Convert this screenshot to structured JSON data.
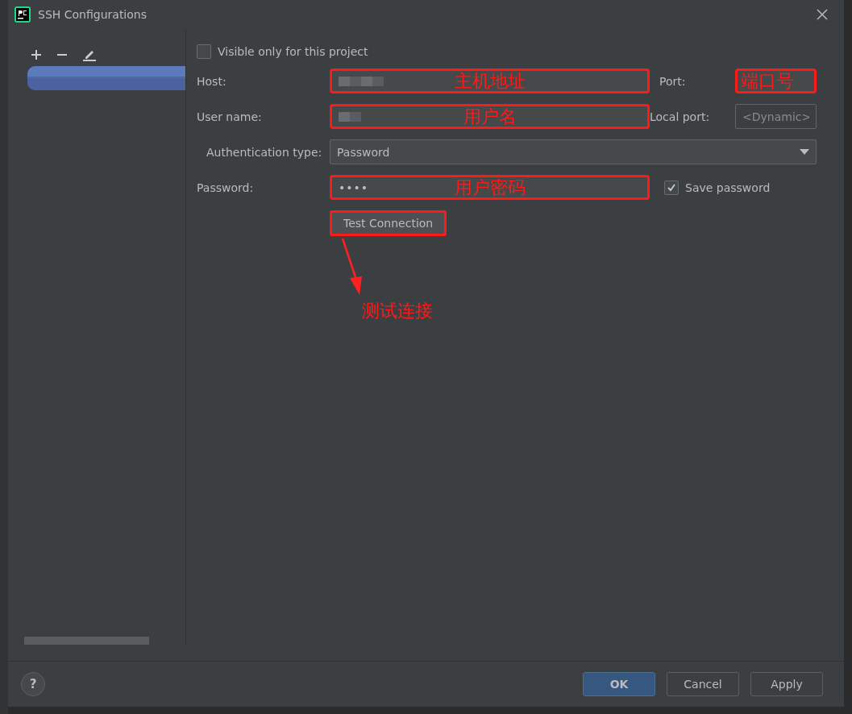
{
  "window": {
    "title": "SSH Configurations"
  },
  "sidebar": {
    "items": [
      {
        "selected": true
      }
    ]
  },
  "form": {
    "visible_only_for_project": {
      "label": "Visible only for this project",
      "checked": false
    },
    "host": {
      "label": "Host:",
      "note": "主机地址",
      "marked": true
    },
    "port": {
      "label": "Port:",
      "note": "端口号",
      "marked": true
    },
    "user_name": {
      "label": "User name:",
      "note": "用户名",
      "marked": true
    },
    "local_port": {
      "label": "Local port:",
      "placeholder": "<Dynamic>"
    },
    "authentication_type": {
      "label": "Authentication type:",
      "value": "Password"
    },
    "password": {
      "label": "Password:",
      "value": "••••",
      "note": "用户密码",
      "marked": true
    },
    "save_password": {
      "label": "Save password",
      "checked": true
    },
    "test_connection": {
      "label": "Test Connection",
      "marked": true,
      "note": "测试连接"
    }
  },
  "help": {
    "label": "?"
  },
  "buttons": [
    {
      "label": "OK",
      "kind": "primary"
    },
    {
      "label": "Cancel",
      "kind": "plain"
    },
    {
      "label": "Apply",
      "kind": "plain"
    }
  ]
}
